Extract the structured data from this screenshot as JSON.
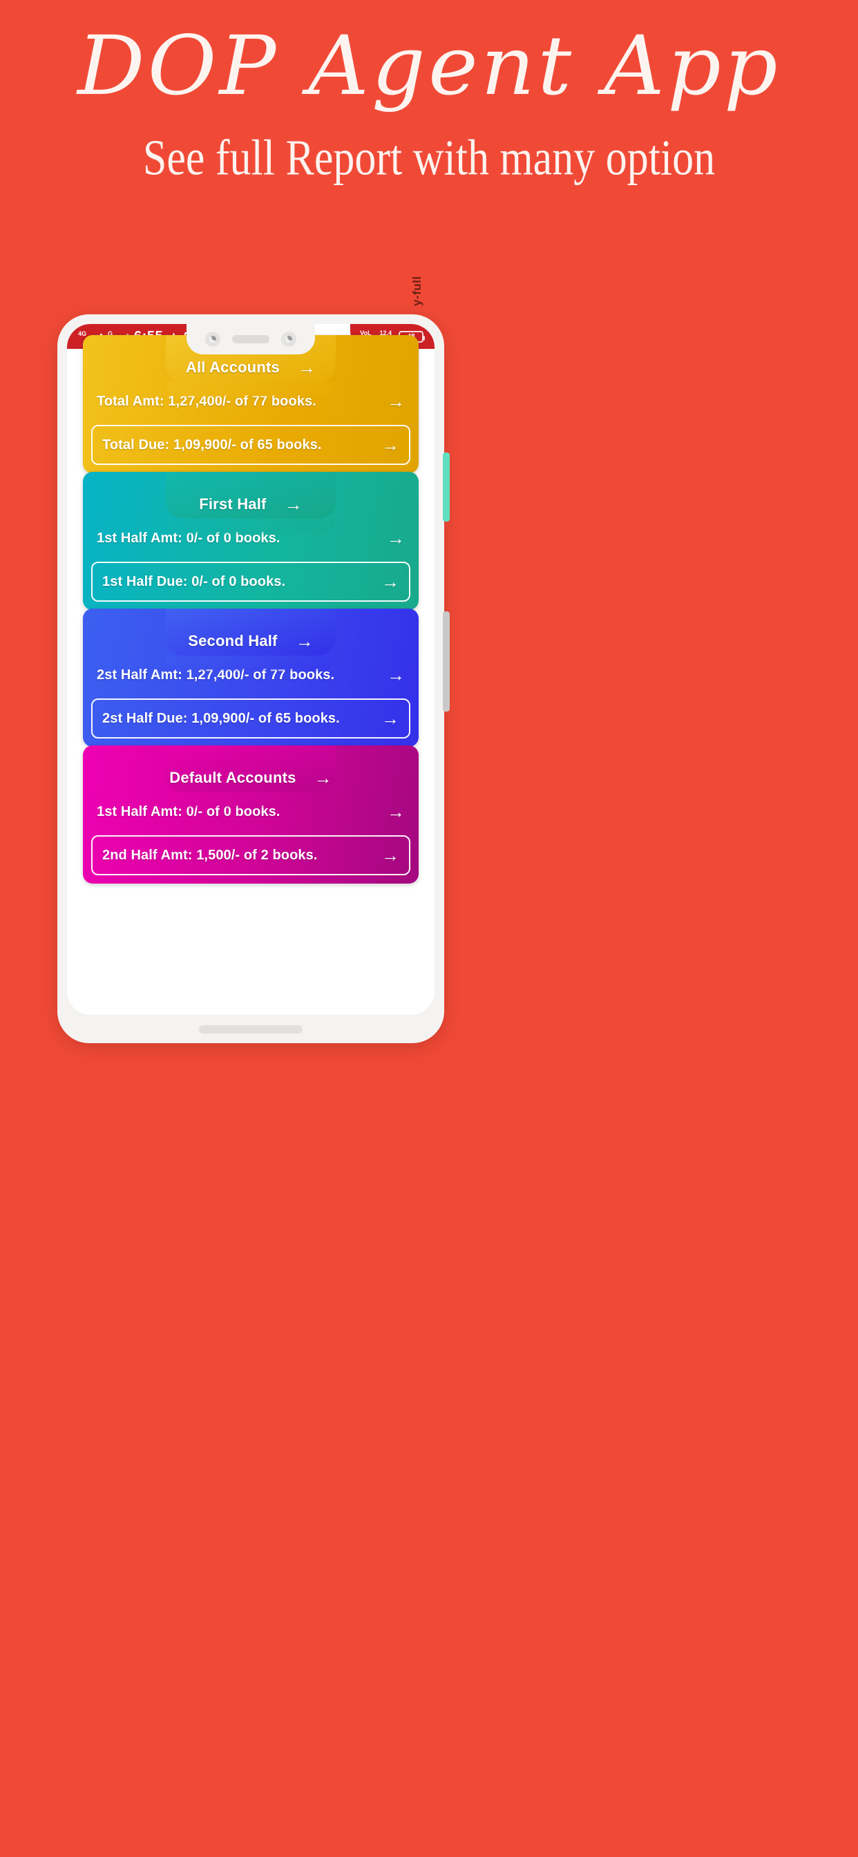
{
  "promo": {
    "title": "DOP Agent App",
    "subtitle": "See full Report with many option"
  },
  "phone": {
    "watermark": "y-full",
    "status_bar": {
      "network_1": "4G",
      "network_2": "G",
      "time": "6:55",
      "alarm_icon": "alarm-icon",
      "media_icon": "play-icon",
      "volte": "VoL\nLTE1",
      "data_rate": "12.4\nKB/s",
      "battery_level": "48"
    },
    "home_indicator": "home-indicator"
  },
  "cards": [
    {
      "id": "all-accounts",
      "theme": "c-yellow",
      "title": "All Accounts",
      "arrow": "→",
      "rows": [
        {
          "label": "Total Amt: 1,27,400/- of 77 books.",
          "arrow": "→",
          "boxed": false
        },
        {
          "label": "Total Due: 1,09,900/- of 65 books.",
          "arrow": "→",
          "boxed": true
        }
      ]
    },
    {
      "id": "first-half",
      "theme": "c-teal",
      "title": "First Half",
      "arrow": "→",
      "rows": [
        {
          "label": "1st Half Amt: 0/- of 0 books.",
          "arrow": "→",
          "boxed": false
        },
        {
          "label": "1st Half Due: 0/- of 0 books.",
          "arrow": "→",
          "boxed": true
        }
      ]
    },
    {
      "id": "second-half",
      "theme": "c-blue",
      "title": "Second Half",
      "arrow": "→",
      "rows": [
        {
          "label": "2st Half Amt: 1,27,400/- of 77 books.",
          "arrow": "→",
          "boxed": false
        },
        {
          "label": "2st Half Due: 1,09,900/- of 65 books.",
          "arrow": "→",
          "boxed": true
        }
      ]
    },
    {
      "id": "default-accounts",
      "theme": "c-magenta",
      "title": "Default Accounts",
      "arrow": "→",
      "rows": [
        {
          "label": "1st Half Amt: 0/- of 0 books.",
          "arrow": "→",
          "boxed": false
        },
        {
          "label": "2nd Half Amt: 1,500/- of 2 books.",
          "arrow": "→",
          "boxed": true
        }
      ]
    }
  ],
  "colors": {
    "background": "#f04a37",
    "status_bar": "#cc2025",
    "yellow": "#e9ab03",
    "teal": "#13b59e",
    "blue": "#3a46ee",
    "magenta": "#cf0497"
  }
}
